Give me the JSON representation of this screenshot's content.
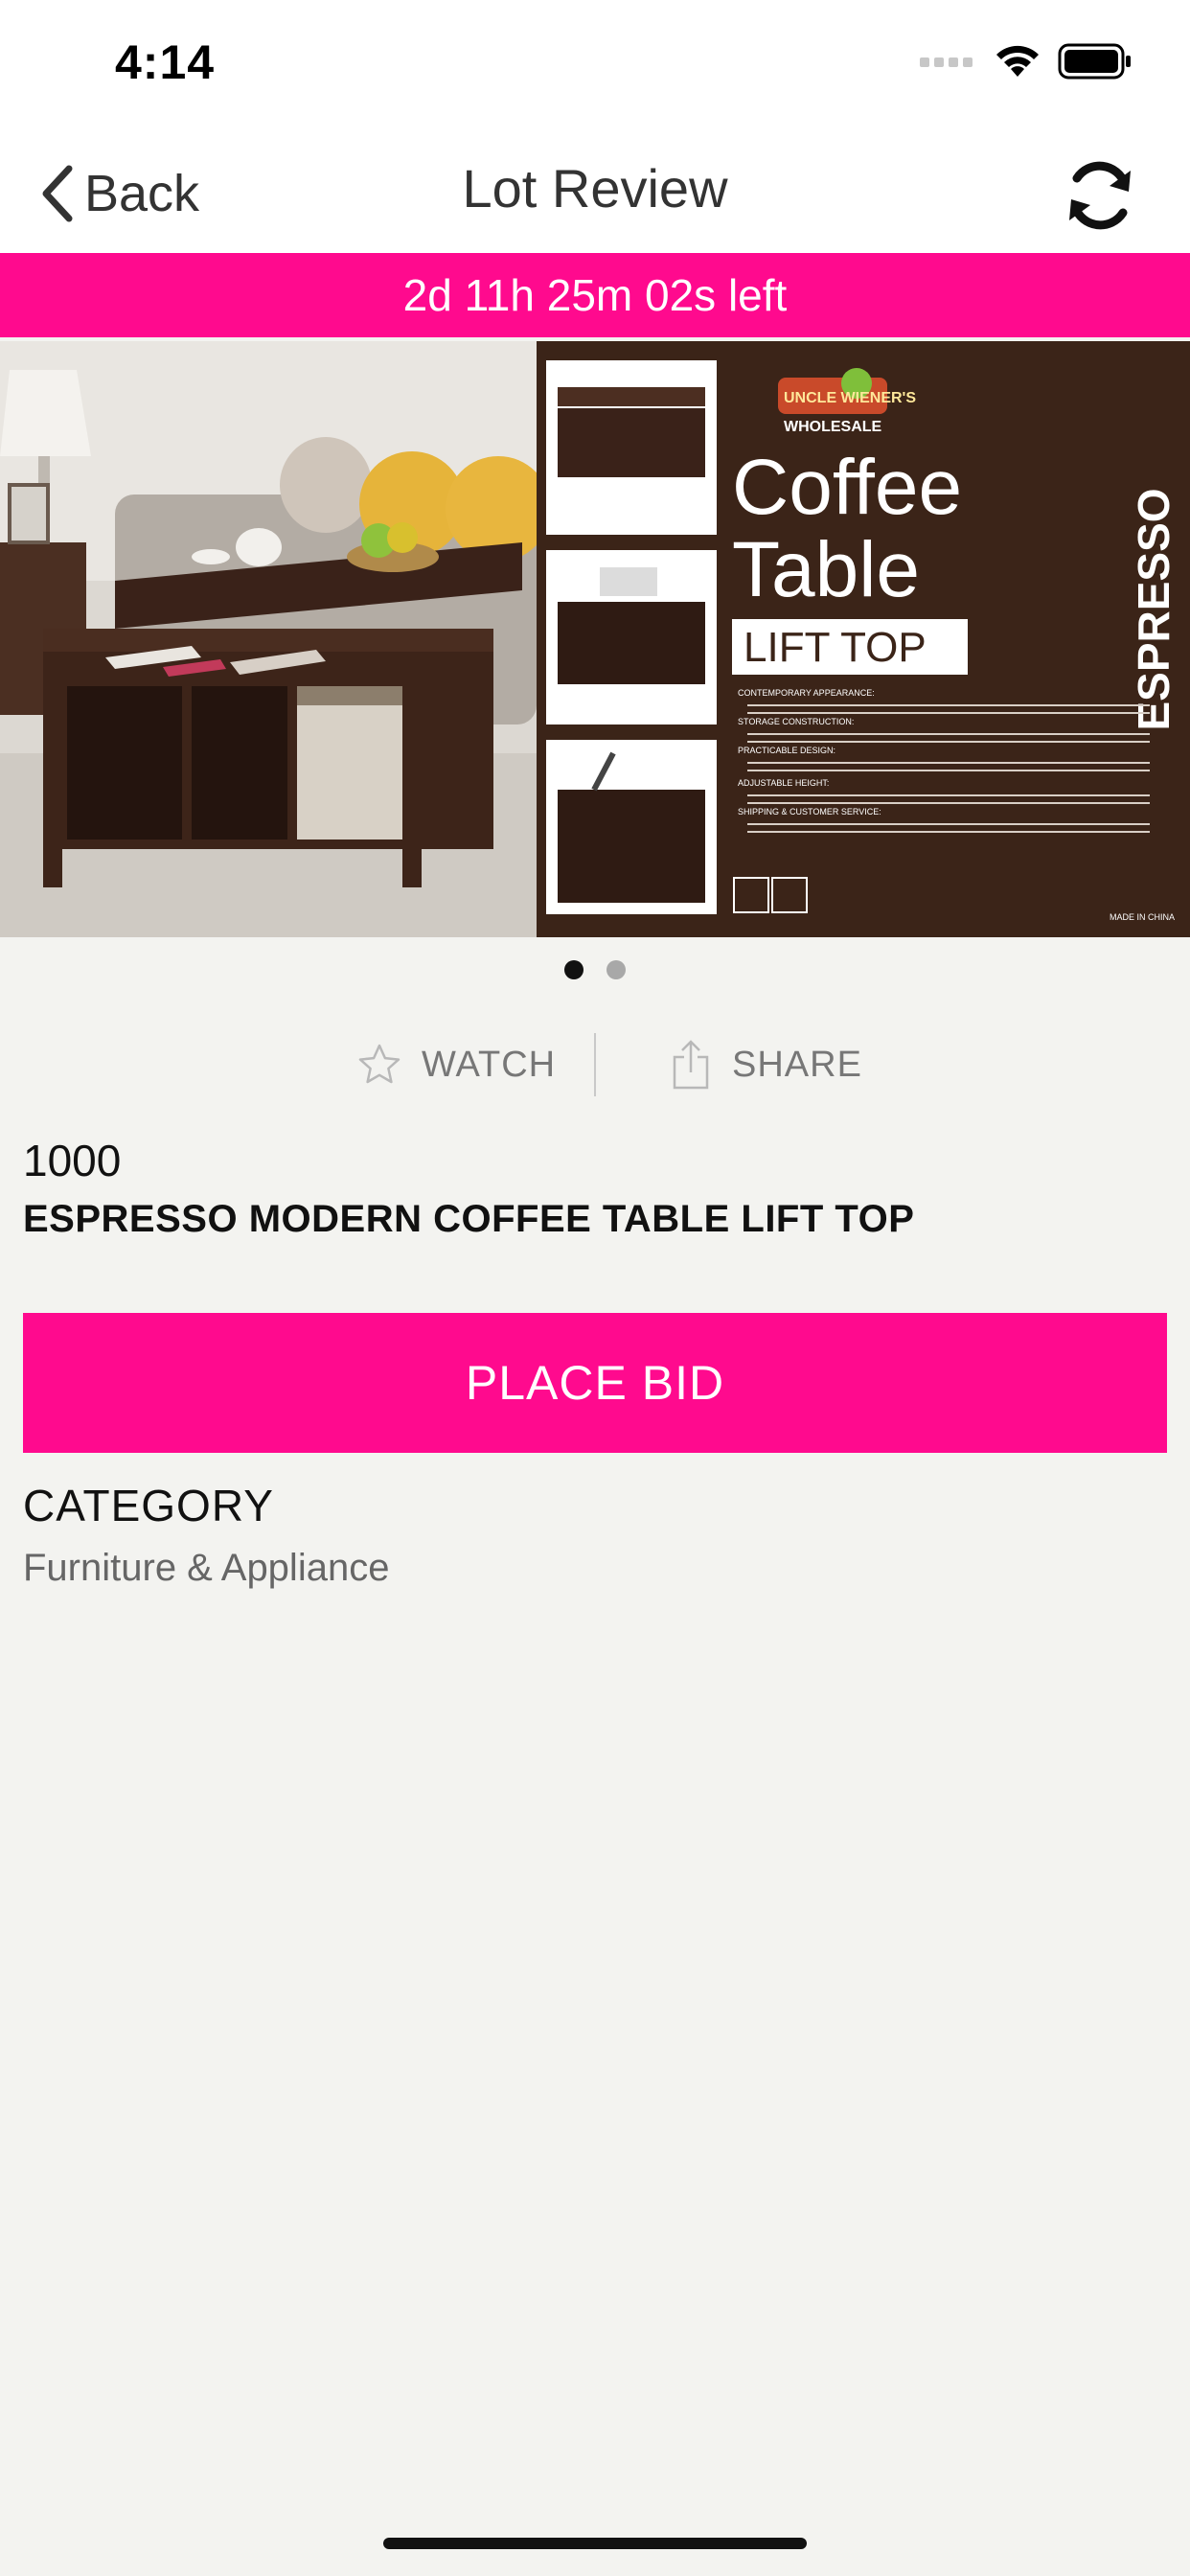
{
  "status_bar": {
    "time": "4:14"
  },
  "nav": {
    "back_label": "Back",
    "title": "Lot Review"
  },
  "timer": {
    "text": "2d 11h 25m 02s left"
  },
  "hero": {
    "image_index": 0,
    "image_count": 2,
    "banner": {
      "brand": "UNCLE WIENER'S",
      "brand_sub": "WHOLESALE",
      "headline_1": "Coffee",
      "headline_2": "Table",
      "headline_3": "LIFT TOP",
      "side_label": "ESPRESSO",
      "made_in": "MADE IN CHINA",
      "bullets": [
        "CONTEMPORARY APPEARANCE:",
        "STORAGE CONSTRUCTION:",
        "PRACTICABLE DESIGN:",
        "ADJUSTABLE HEIGHT:",
        "SHIPPING & CUSTOMER SERVICE:"
      ]
    }
  },
  "actions": {
    "watch_label": "WATCH",
    "share_label": "SHARE"
  },
  "lot": {
    "number": "1000",
    "title": "ESPRESSO MODERN COFFEE TABLE LIFT TOP"
  },
  "bid": {
    "button_label": "PLACE BID"
  },
  "category": {
    "heading": "CATEGORY",
    "value": "Furniture & Appliance"
  },
  "colors": {
    "accent": "#ff0a8e",
    "banner_brown": "#3b2418",
    "background": "#f3f3f0"
  }
}
